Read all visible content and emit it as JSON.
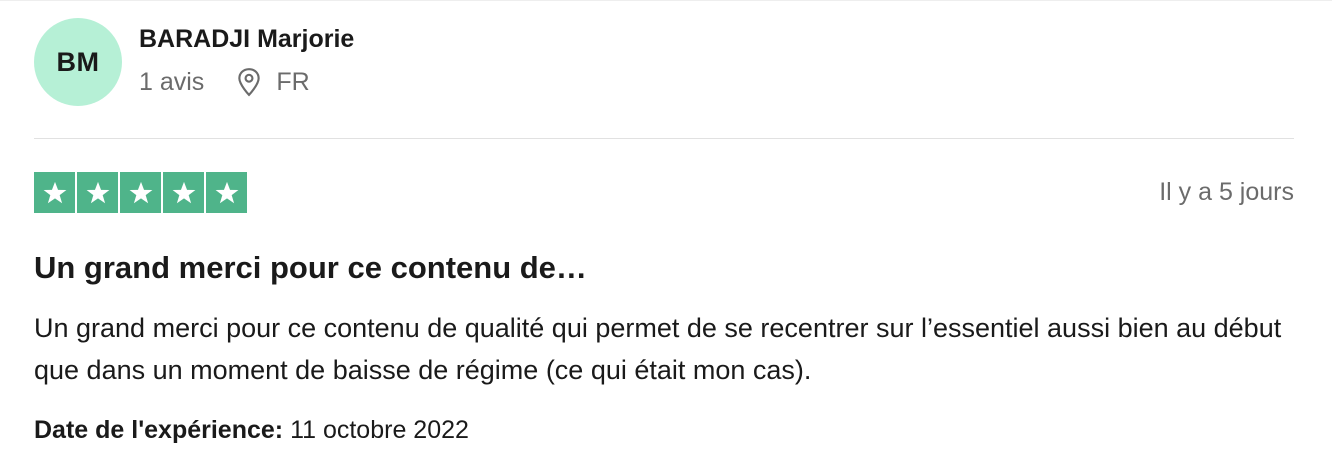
{
  "reviewer": {
    "initials": "BM",
    "avatar_color": "#b6f0d6",
    "name": "BARADJI Marjorie",
    "review_count": "1 avis",
    "location_icon": "location-pin-icon",
    "country": "FR"
  },
  "review": {
    "rating": 5,
    "rating_max": 5,
    "star_color": "#4fb48a",
    "time_ago": "Il y a 5 jours",
    "title": "Un grand merci pour ce contenu de…",
    "text": "Un grand merci pour ce contenu de qualité qui permet de se recentrer sur l’essentiel aussi bien au début que dans un moment de baisse de régime (ce qui était mon cas).",
    "experience_label": "Date de l'expérience:",
    "experience_date": "11 octobre 2022"
  }
}
